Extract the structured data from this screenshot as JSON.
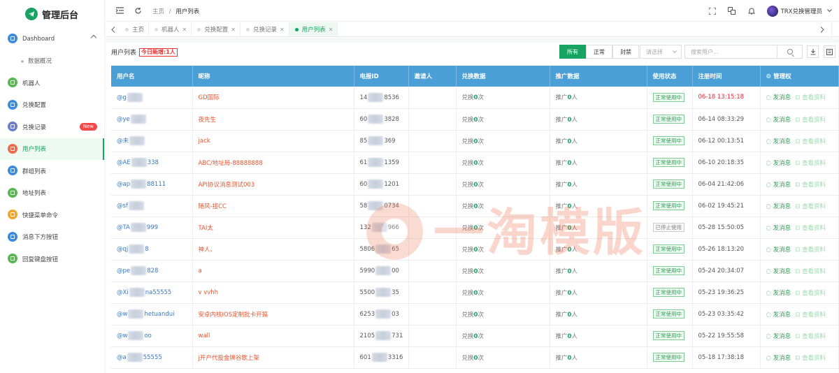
{
  "app": {
    "title": "管理后台"
  },
  "sidebar": {
    "items": [
      {
        "label": "Dashboard",
        "icon": "home-icon",
        "color": "#3b8be0"
      },
      {
        "label": "数据概况",
        "sub": true
      },
      {
        "label": "机器人",
        "icon": "monitor-icon",
        "color": "#5ab553"
      },
      {
        "label": "兑换配置",
        "icon": "swap-icon",
        "color": "#3b8be0"
      },
      {
        "label": "兑换记录",
        "icon": "doc-icon",
        "color": "#6a7ec9",
        "badge": "New"
      },
      {
        "label": "用户列表",
        "icon": "user-icon",
        "color": "#f06a4a",
        "active": true
      },
      {
        "label": "群组列表",
        "icon": "group-icon",
        "color": "#3b8be0"
      },
      {
        "label": "地址列表",
        "icon": "location-icon",
        "color": "#5ab553"
      },
      {
        "label": "快捷菜单命令",
        "icon": "command-icon",
        "color": "#f0a52c"
      },
      {
        "label": "消息下方按钮",
        "icon": "button-icon",
        "color": "#3b8be0"
      },
      {
        "label": "回复键盘按钮",
        "icon": "keyboard-icon",
        "color": "#5ab553"
      }
    ]
  },
  "topbar": {
    "breadcrumb": [
      "主页",
      "用户列表"
    ],
    "user": "TRX兑换管理员"
  },
  "tabs": [
    {
      "label": "主页",
      "close": false
    },
    {
      "label": "机器人",
      "close": true
    },
    {
      "label": "兑换配置",
      "close": true
    },
    {
      "label": "兑换记录",
      "close": true
    },
    {
      "label": "用户列表",
      "close": true,
      "active": true
    }
  ],
  "panel": {
    "title": "用户列表",
    "today_badge": "今日新增:1人",
    "filters": [
      "所有",
      "正常",
      "封禁"
    ],
    "select_placeholder": "请选择",
    "search_placeholder": "搜索用户..."
  },
  "table": {
    "headers": [
      "用户名",
      "昵称",
      "电报ID",
      "邀请人",
      "兑换数据",
      "推广数据",
      "使用状态",
      "注册时间",
      "管理权"
    ],
    "exchange_prefix": "兑换",
    "exchange_suffix": "次",
    "promo_prefix": "推广",
    "promo_suffix": "人",
    "action_send": "发消息",
    "action_view": "查看资料",
    "rows": [
      {
        "u1": "@g",
        "u2": "",
        "nick": "GD国际",
        "id1": "14",
        "id2": "8536",
        "ex": "0",
        "pr": "0",
        "status": "正常使用中",
        "off": false,
        "time": "06-18 13:15:18",
        "red": true
      },
      {
        "u1": "@ye",
        "u2": "",
        "nick": "夜先生",
        "id1": "60",
        "id2": "3828",
        "ex": "0",
        "pr": "0",
        "status": "正常使用中",
        "off": false,
        "time": "06-14 08:33:29",
        "red": false
      },
      {
        "u1": "@未",
        "u2": "",
        "nick": "jack",
        "id1": "85",
        "id2": "369",
        "ex": "0",
        "pr": "0",
        "status": "正常使用中",
        "off": false,
        "time": "06-12 00:13:51",
        "red": false
      },
      {
        "u1": "@AE",
        "u2": "338",
        "nick": "ABC/地址局-88888888",
        "id1": "61",
        "id2": "1359",
        "ex": "0",
        "pr": "0",
        "status": "正常使用中",
        "off": false,
        "time": "06-10 20:18:35",
        "red": false
      },
      {
        "u1": "@ap",
        "u2": "88111",
        "nick": "API协议消息测试003",
        "id1": "60",
        "id2": "1201",
        "ex": "0",
        "pr": "0",
        "status": "正常使用中",
        "off": false,
        "time": "06-04 21:42:06",
        "red": false
      },
      {
        "u1": "@sf",
        "u2": "",
        "nick": "随风-接CC",
        "id1": "58",
        "id2": "0734",
        "ex": "0",
        "pr": "0",
        "status": "正常使用中",
        "off": false,
        "time": "06-02 19:45:21",
        "red": false
      },
      {
        "u1": "@TA",
        "u2": "999",
        "nick": "TAI太",
        "id1": "132",
        "id2": "966",
        "ex": "0",
        "pr": "0",
        "status": "已停止使用",
        "off": true,
        "time": "05-28 15:50:05",
        "red": false
      },
      {
        "u1": "@qj",
        "u2": "8",
        "nick": "神人、",
        "id1": "5806",
        "id2": "65",
        "ex": "0",
        "pr": "0",
        "status": "正常使用中",
        "off": false,
        "time": "05-26 18:13:20",
        "red": false
      },
      {
        "u1": "@pe",
        "u2": "828",
        "nick": "a",
        "id1": "5990",
        "id2": "00",
        "ex": "0",
        "pr": "0",
        "status": "正常使用中",
        "off": false,
        "time": "05-24 20:34:07",
        "red": false
      },
      {
        "u1": "@Xi",
        "u2": "na55555",
        "nick": "v vvhh",
        "id1": "5500",
        "id2": "35",
        "ex": "0",
        "pr": "0",
        "status": "正常使用中",
        "off": false,
        "time": "05-23 19:36:25",
        "red": false
      },
      {
        "u1": "@w",
        "u2": "hetuandui",
        "nick": "安卓内核IOS定制批卡开搞",
        "id1": "6253",
        "id2": "03",
        "ex": "0",
        "pr": "0",
        "status": "正常使用中",
        "off": false,
        "time": "05-23 03:35:42",
        "red": false
      },
      {
        "u1": "@w",
        "u2": "oo",
        "nick": "wall",
        "id1": "2105",
        "id2": "731",
        "ex": "0",
        "pr": "0",
        "status": "正常使用中",
        "off": false,
        "time": "05-22 19:55:58",
        "red": false
      },
      {
        "u1": "@a",
        "u2": "55555",
        "nick": "j开户代投金牌谷歌上架",
        "id1": "601",
        "id2": "3316",
        "ex": "0",
        "pr": "0",
        "status": "正常使用中",
        "off": false,
        "time": "05-18 17:38:18",
        "red": false
      }
    ]
  },
  "watermark": {
    "text": "一淘模版"
  },
  "colors": {
    "accent": "#17a462",
    "header": "#4a9fd6",
    "nick": "#e8532d",
    "user": "#3a78c3"
  }
}
